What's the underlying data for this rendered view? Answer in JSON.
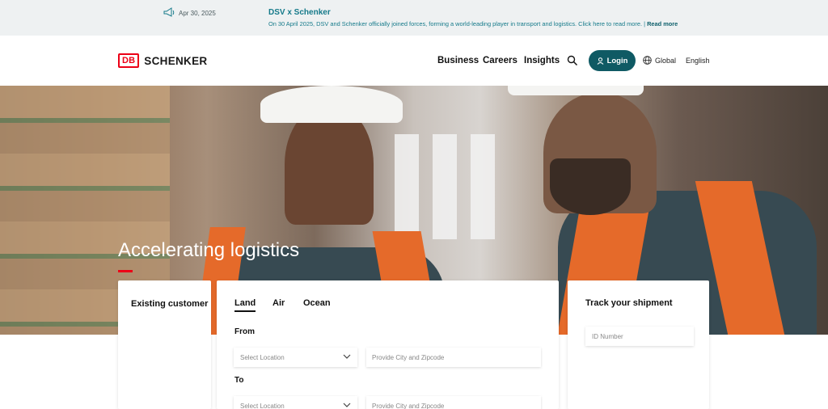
{
  "announcement": {
    "date": "Apr 30, 2025",
    "title": "DSV x Schenker",
    "message": "On 30 April 2025, DSV and Schenker officially joined forces, forming a world-leading player in transport and logistics. Click here to read more. |",
    "read_more": "Read more",
    "icon": "megaphone-icon"
  },
  "header": {
    "logo_db": "DB",
    "logo_name": "SCHENKER",
    "nav": [
      "Business",
      "Careers",
      "Insights"
    ],
    "login_label": "Login",
    "global_label": "Global",
    "language_label": "English",
    "accent_color": "#0f5a64",
    "brand_color": "#ec0016"
  },
  "hero": {
    "headline": "Accelerating logistics"
  },
  "existing_customer": {
    "label": "Existing customer"
  },
  "quote": {
    "tabs": [
      "Land",
      "Air",
      "Ocean"
    ],
    "active_tab": "Land",
    "from_label": "From",
    "to_label": "To",
    "select_placeholder": "Select Location",
    "city_placeholder": "Provide City and Zipcode"
  },
  "tracking": {
    "label": "Track your shipment",
    "id_placeholder": "ID Number"
  }
}
